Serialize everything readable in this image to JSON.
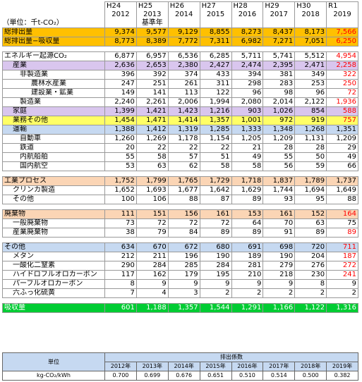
{
  "header": {
    "unit_label": "（単位：千t-CO₂）",
    "eras": [
      "H24",
      "H25",
      "H26",
      "H27",
      "H28",
      "H29",
      "H30",
      "R1"
    ],
    "years": [
      "2012",
      "2013",
      "2014",
      "2015",
      "2016",
      "2017",
      "2018",
      "2019"
    ],
    "base_year_note": "基準年"
  },
  "rows": [
    {
      "label": "総排出量",
      "values": [
        "9,374",
        "9,577",
        "9,129",
        "8,855",
        "8,273",
        "8,437",
        "8,173",
        "7,566"
      ]
    },
    {
      "label": "総排出量−吸収量",
      "values": [
        "8,773",
        "8,389",
        "7,772",
        "7,311",
        "6,982",
        "7,271",
        "7,051",
        "6,250"
      ]
    },
    {
      "label": "エネルギー起源CO₂",
      "values": [
        "6,877",
        "6,957",
        "6,536",
        "6,285",
        "5,711",
        "5,741",
        "5,512",
        "4,954"
      ]
    },
    {
      "label": "産業",
      "values": [
        "2,636",
        "2,653",
        "2,380",
        "2,427",
        "2,474",
        "2,395",
        "2,471",
        "2,258"
      ]
    },
    {
      "label": "非製造業",
      "values": [
        "396",
        "392",
        "374",
        "433",
        "394",
        "381",
        "349",
        "322"
      ]
    },
    {
      "label": "農林水産業",
      "values": [
        "247",
        "251",
        "261",
        "311",
        "298",
        "283",
        "253",
        "250"
      ]
    },
    {
      "label": "建設業・鉱業",
      "values": [
        "149",
        "141",
        "113",
        "122",
        "96",
        "98",
        "96",
        "72"
      ]
    },
    {
      "label": "製造業",
      "values": [
        "2,240",
        "2,261",
        "2,006",
        "1,994",
        "2,080",
        "2,014",
        "2,122",
        "1,936"
      ]
    },
    {
      "label": "家庭",
      "values": [
        "1,399",
        "1,421",
        "1,423",
        "1,216",
        "903",
        "1,026",
        "854",
        "588"
      ]
    },
    {
      "label": "業務その他",
      "values": [
        "1,454",
        "1,471",
        "1,414",
        "1,357",
        "1,001",
        "972",
        "919",
        "757"
      ]
    },
    {
      "label": "運輸",
      "values": [
        "1,388",
        "1,412",
        "1,319",
        "1,285",
        "1,333",
        "1,348",
        "1,268",
        "1,351"
      ]
    },
    {
      "label": "自動車",
      "values": [
        "1,260",
        "1,269",
        "1,178",
        "1,154",
        "1,205",
        "1,209",
        "1,131",
        "1,209"
      ]
    },
    {
      "label": "鉄道",
      "values": [
        "20",
        "22",
        "22",
        "22",
        "21",
        "28",
        "28",
        "29"
      ]
    },
    {
      "label": "内航船舶",
      "values": [
        "55",
        "58",
        "57",
        "51",
        "49",
        "55",
        "50",
        "49"
      ]
    },
    {
      "label": "国内航空",
      "values": [
        "53",
        "63",
        "62",
        "58",
        "58",
        "56",
        "59",
        "66"
      ]
    },
    {
      "label": "工業プロセス",
      "values": [
        "1,752",
        "1,799",
        "1,765",
        "1,729",
        "1,718",
        "1,837",
        "1,789",
        "1,737"
      ]
    },
    {
      "label": "クリンカ製造",
      "values": [
        "1,652",
        "1,693",
        "1,677",
        "1,642",
        "1,629",
        "1,744",
        "1,694",
        "1,649"
      ]
    },
    {
      "label": "その他",
      "values": [
        "100",
        "106",
        "88",
        "87",
        "89",
        "93",
        "95",
        "88"
      ]
    },
    {
      "label": "廃棄物",
      "values": [
        "111",
        "151",
        "156",
        "161",
        "153",
        "161",
        "152",
        "164"
      ]
    },
    {
      "label": "一般廃棄物",
      "values": [
        "73",
        "72",
        "72",
        "72",
        "64",
        "70",
        "63",
        "75"
      ]
    },
    {
      "label": "産業廃棄物",
      "values": [
        "38",
        "79",
        "84",
        "89",
        "89",
        "91",
        "89",
        "89"
      ]
    },
    {
      "label": "その他",
      "values": [
        "634",
        "670",
        "672",
        "680",
        "691",
        "698",
        "720",
        "711"
      ]
    },
    {
      "label": "メタン",
      "values": [
        "212",
        "211",
        "196",
        "190",
        "189",
        "190",
        "204",
        "187"
      ]
    },
    {
      "label": "一酸化二窒素",
      "values": [
        "290",
        "284",
        "285",
        "284",
        "281",
        "279",
        "276",
        "272"
      ]
    },
    {
      "label": "ハイドロフルオロカーボン",
      "values": [
        "117",
        "162",
        "179",
        "195",
        "210",
        "218",
        "230",
        "241"
      ]
    },
    {
      "label": "パーフルオロカーボン",
      "values": [
        "8",
        "9",
        "9",
        "9",
        "9",
        "9",
        "8",
        "9"
      ]
    },
    {
      "label": "六ふっ化硫黄",
      "values": [
        "7",
        "4",
        "3",
        "2",
        "2",
        "2",
        "2",
        "2"
      ]
    },
    {
      "label": "吸収量",
      "values": [
        "601",
        "1,188",
        "1,357",
        "1,544",
        "1,291",
        "1,166",
        "1,122",
        "1,316"
      ]
    }
  ],
  "coefficients": {
    "unit_header": "単位",
    "title": "排出係数",
    "years": [
      "2012年",
      "2013年",
      "2014年",
      "2015年",
      "2016年",
      "2017年",
      "2018年",
      "2019年"
    ],
    "unit": "kg-CO₂/kWh",
    "values": [
      "0.700",
      "0.699",
      "0.676",
      "0.651",
      "0.510",
      "0.514",
      "0.500",
      "0.382"
    ]
  }
}
